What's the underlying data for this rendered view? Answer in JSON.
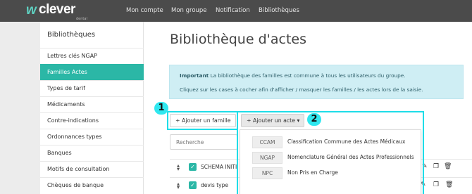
{
  "logo": {
    "mark": "w",
    "name": "clever",
    "sub": "dental"
  },
  "nav": {
    "items": [
      "Mon compte",
      "Mon groupe",
      "Notification",
      "Bibliothèques"
    ]
  },
  "sidebar": {
    "title": "Bibliothèques",
    "items": [
      {
        "label": "Lettres clés NGAP",
        "active": false
      },
      {
        "label": "Familles Actes",
        "active": true
      },
      {
        "label": "Types de tarif",
        "active": false
      },
      {
        "label": "Médicaments",
        "active": false
      },
      {
        "label": "Contre-indications",
        "active": false
      },
      {
        "label": "Ordonnances types",
        "active": false
      },
      {
        "label": "Banques",
        "active": false
      },
      {
        "label": "Motifs de consultation",
        "active": false
      },
      {
        "label": "Chèques de banque",
        "active": false
      }
    ]
  },
  "main": {
    "title": "Bibliothèque d'actes",
    "alert": {
      "strong": "Important",
      "line1": " La bibliothèque des familles est commune à tous les utilisateurs du groupe.",
      "line2": "Cliquez sur les cases à cocher afin d'afficher / masquer les familles / les actes lors de la saisie."
    },
    "buttons": {
      "add_family": "+ Ajouter un famille",
      "add_act": "+ Ajouter un acte ▾"
    },
    "badges": {
      "one": "1",
      "two": "2"
    },
    "search_placeholder": "Recherche",
    "dropdown": [
      {
        "code": "CCAM",
        "label": "Classification Commune des Actes Médicaux"
      },
      {
        "code": "NGAP",
        "label": "Nomenclature Général des Actes Professionnels"
      },
      {
        "code": "NPC",
        "label": "Non Pris en Charge"
      }
    ],
    "rows": [
      {
        "label": "SCHEMA INITI",
        "checked": true
      },
      {
        "label": "devis type",
        "checked": true
      }
    ]
  },
  "icons": {
    "drag": "updown-arrows-icon",
    "check": "checkmark-icon",
    "edit": "pencil-icon",
    "copy": "copy-icon",
    "delete": "trash-icon"
  },
  "colors": {
    "topbar": "#4b4b4b",
    "accent": "#2bb7a6",
    "highlight": "#1fdde8",
    "alert_bg": "#cfeef4"
  }
}
